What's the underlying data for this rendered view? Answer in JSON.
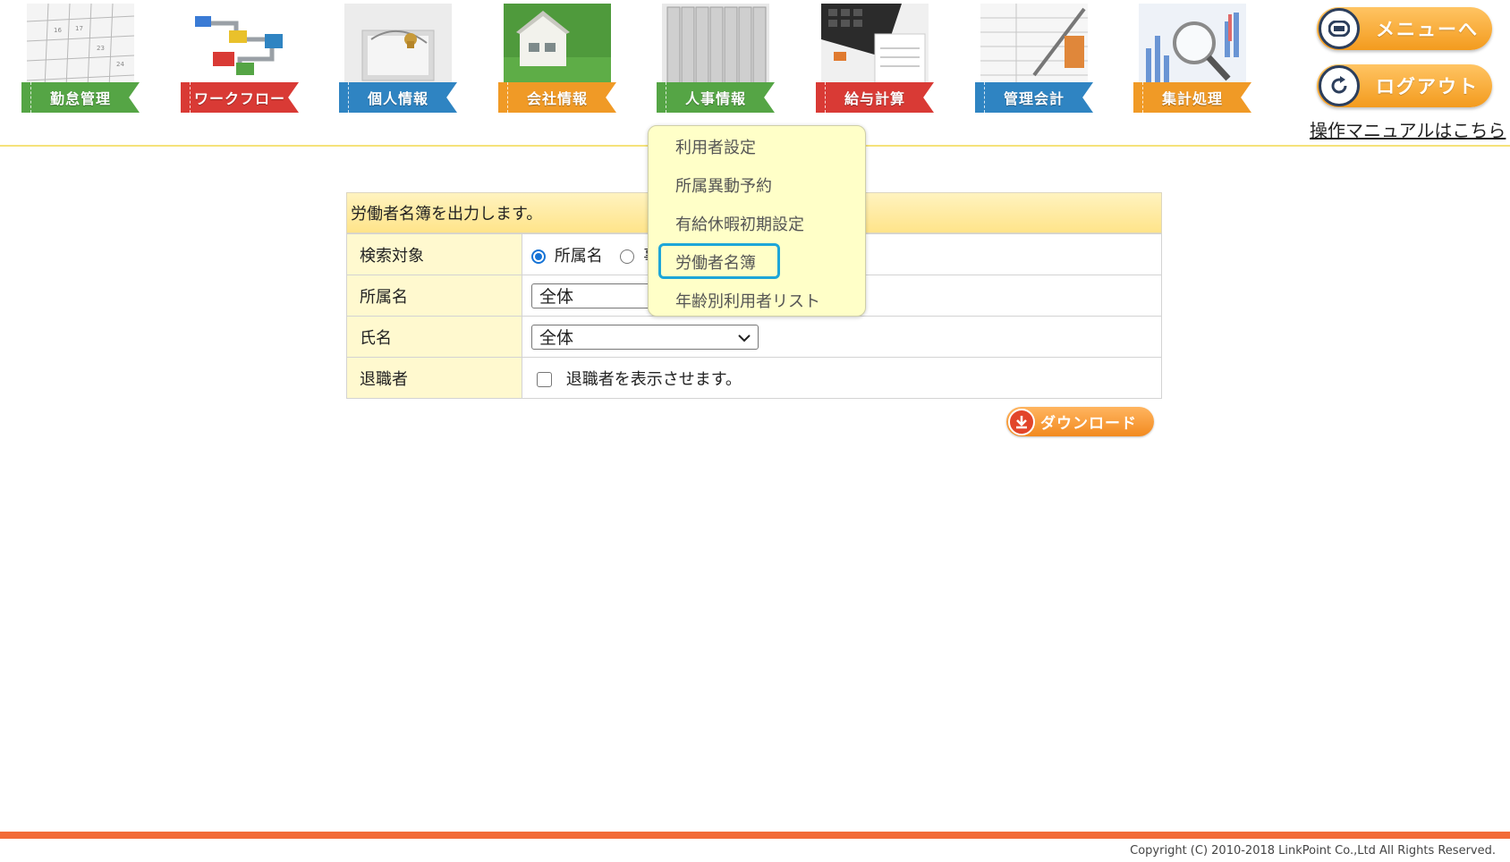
{
  "nav": {
    "items": [
      {
        "label": "勤怠管理"
      },
      {
        "label": "ワークフロー"
      },
      {
        "label": "個人情報"
      },
      {
        "label": "会社情報"
      },
      {
        "label": "人事情報"
      },
      {
        "label": "給与計算"
      },
      {
        "label": "管理会計"
      },
      {
        "label": "集計処理"
      }
    ],
    "colors": {
      "green": "#55a545",
      "red": "#d93a35",
      "blue": "#2f84c2",
      "orange": "#f09a26"
    }
  },
  "header": {
    "menu_button": "メニューへ",
    "logout_button": "ログアウト",
    "manual_link": "操作マニュアルはこちら"
  },
  "form": {
    "caption": "労働者名簿を出力します。",
    "rows": {
      "search_target": {
        "label": "検索対象",
        "option1": "所属名",
        "option2_partial": "事"
      },
      "department": {
        "label": "所属名",
        "value": "全体"
      },
      "name": {
        "label": "氏名",
        "value": "全体"
      },
      "retired": {
        "label": "退職者",
        "checkbox_label": "退職者を表示させます。"
      }
    },
    "download_button": "ダウンロード"
  },
  "dropdown": {
    "items": [
      {
        "label": "利用者設定"
      },
      {
        "label": "所属異動予約"
      },
      {
        "label": "有給休暇初期設定"
      },
      {
        "label": "労働者名簿"
      },
      {
        "label": "年齢別利用者リスト"
      }
    ],
    "highlight_color": "#1ea6d8"
  },
  "footer": {
    "copyright": "Copyright (C) 2010-2018 LinkPoint Co.,Ltd All Rights Reserved."
  }
}
